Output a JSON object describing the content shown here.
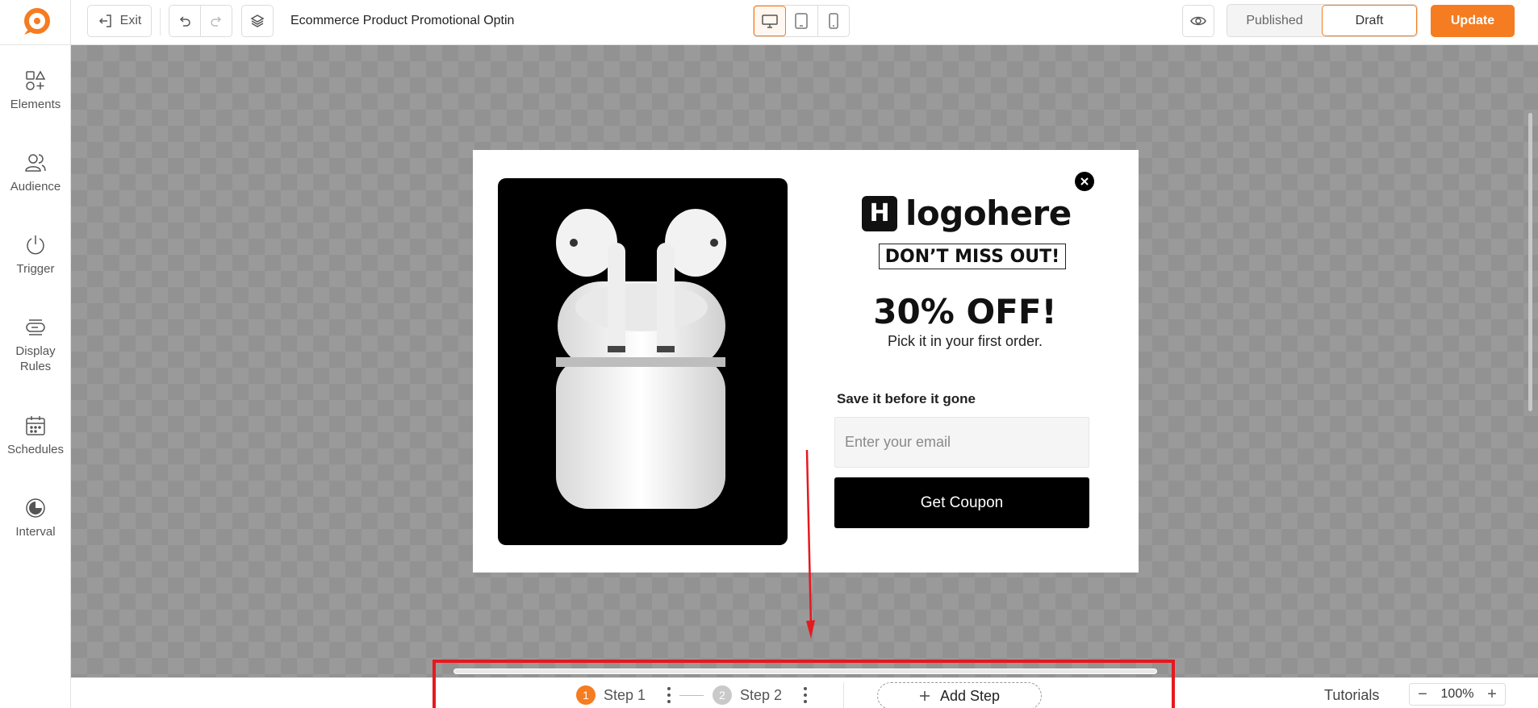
{
  "header": {
    "exit_label": "Exit",
    "page_title": "Ecommerce Product Promotional Optin",
    "status_published": "Published",
    "status_draft": "Draft",
    "update_label": "Update"
  },
  "colors": {
    "accent": "#f57c20",
    "annotation": "#e5191f"
  },
  "sidebar": {
    "items": [
      {
        "label": "Elements",
        "icon": "elements-icon"
      },
      {
        "label": "Audience",
        "icon": "audience-icon"
      },
      {
        "label": "Trigger",
        "icon": "power-icon"
      },
      {
        "label": "Display Rules",
        "icon": "display-rules-icon"
      },
      {
        "label": "Schedules",
        "icon": "calendar-icon"
      },
      {
        "label": "Interval",
        "icon": "interval-icon"
      }
    ]
  },
  "popup": {
    "brand_mark": "H",
    "brand_name": "logohere",
    "headline": "DON’T MISS OUT!",
    "offer": "30% OFF!",
    "offer_sub": "Pick it in your first order.",
    "save_label": "Save it before it gone",
    "email_placeholder": "Enter your email",
    "button_label": "Get Coupon"
  },
  "footer": {
    "steps": [
      {
        "num": "1",
        "label": "Step 1"
      },
      {
        "num": "2",
        "label": "Step 2"
      }
    ],
    "add_step": "Add Step",
    "tutorials": "Tutorials",
    "zoom": "100%"
  }
}
